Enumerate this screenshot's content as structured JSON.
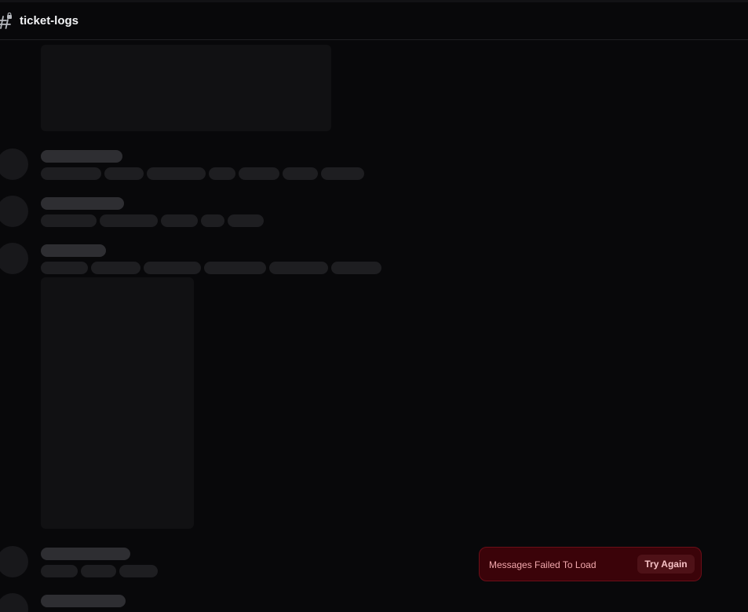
{
  "header": {
    "channel_name": "ticket-logs",
    "channel_icon": "hashtag-lock-icon"
  },
  "toast": {
    "message": "Messages Failed To Load",
    "retry_label": "Try Again"
  },
  "colors": {
    "background": "#08080a",
    "skeleton_name": "#2e2e32",
    "skeleton_word": "#1e1e21",
    "toast_bg": "#3b0309",
    "toast_text": "#f2a8ad"
  }
}
